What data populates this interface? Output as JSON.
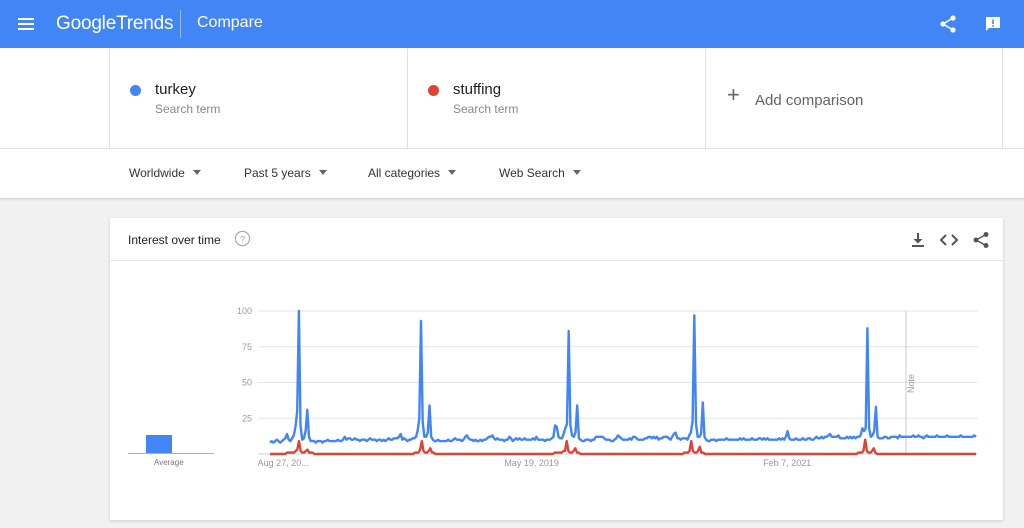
{
  "header": {
    "logo_google": "Google",
    "logo_trends": "Trends",
    "page_title": "Compare"
  },
  "terms": [
    {
      "name": "turkey",
      "subtitle": "Search term",
      "color": "#4285f4"
    },
    {
      "name": "stuffing",
      "subtitle": "Search term",
      "color": "#db4437"
    }
  ],
  "add_comparison": {
    "label": "Add comparison"
  },
  "filters": {
    "region": "Worldwide",
    "time": "Past 5 years",
    "category": "All categories",
    "search_type": "Web Search"
  },
  "card": {
    "title": "Interest over time",
    "average_label": "Average",
    "note_label": "Note"
  },
  "icons": [
    "menu-icon",
    "share-icon",
    "feedback-icon",
    "help-icon",
    "download-icon",
    "embed-icon",
    "share-icon"
  ],
  "chart_data": {
    "type": "line",
    "title": "",
    "x_tick_labels": [
      "Aug 27, 20...",
      "May 19, 2019",
      "Feb 7, 2021"
    ],
    "y_ticks": [
      25,
      50,
      75,
      100
    ],
    "ylim": [
      0,
      100
    ],
    "grid": true,
    "averages": {
      "turkey": 13,
      "stuffing": 1
    },
    "series": [
      {
        "name": "turkey",
        "color": "#4285f4",
        "values": [
          8,
          9,
          8,
          9,
          10,
          9,
          8,
          9,
          10,
          11,
          14,
          10,
          9,
          11,
          13,
          19,
          30,
          100,
          20,
          10,
          11,
          16,
          31,
          12,
          9,
          9,
          9,
          8,
          9,
          9,
          9,
          8,
          9,
          9,
          10,
          9,
          9,
          9,
          9,
          9,
          10,
          9,
          9,
          10,
          12,
          10,
          11,
          11,
          10,
          10,
          11,
          10,
          10,
          9,
          10,
          10,
          10,
          9,
          10,
          11,
          10,
          10,
          10,
          9,
          10,
          10,
          9,
          10,
          9,
          10,
          11,
          10,
          10,
          11,
          11,
          11,
          12,
          14,
          10,
          11,
          10,
          9,
          10,
          10,
          11,
          11,
          12,
          16,
          25,
          93,
          22,
          12,
          12,
          15,
          34,
          12,
          10,
          9,
          9,
          10,
          9,
          9,
          9,
          9,
          9,
          10,
          9,
          9,
          10,
          11,
          10,
          10,
          10,
          9,
          10,
          12,
          13,
          11,
          10,
          10,
          9,
          10,
          9,
          9,
          10,
          9,
          10,
          10,
          11,
          12,
          12,
          13,
          11,
          10,
          11,
          10,
          10,
          10,
          9,
          10,
          10,
          12,
          11,
          9,
          10,
          11,
          10,
          11,
          10,
          10,
          11,
          10,
          10,
          10,
          10,
          11,
          10,
          12,
          10,
          10,
          10,
          10,
          9,
          10,
          10,
          10,
          11,
          12,
          20,
          19,
          12,
          11,
          11,
          14,
          18,
          21,
          86,
          20,
          13,
          12,
          15,
          34,
          11,
          10,
          9,
          9,
          10,
          10,
          10,
          9,
          10,
          10,
          12,
          12,
          12,
          12,
          12,
          11,
          10,
          10,
          10,
          9,
          9,
          10,
          11,
          13,
          12,
          11,
          10,
          10,
          10,
          10,
          11,
          10,
          12,
          12,
          11,
          10,
          10,
          10,
          10,
          11,
          11,
          12,
          12,
          11,
          12,
          11,
          12,
          10,
          11,
          11,
          12,
          12,
          12,
          11,
          10,
          12,
          14,
          15,
          11,
          11,
          10,
          11,
          11,
          11,
          10,
          13,
          15,
          23,
          97,
          21,
          12,
          12,
          14,
          36,
          12,
          10,
          9,
          9,
          10,
          10,
          10,
          9,
          10,
          10,
          10,
          10,
          10,
          11,
          10,
          10,
          10,
          10,
          10,
          10,
          10,
          11,
          10,
          11,
          10,
          10,
          10,
          10,
          11,
          10,
          10,
          10,
          11,
          11,
          10,
          11,
          10,
          11,
          10,
          10,
          10,
          10,
          10,
          10,
          11,
          10,
          11,
          10,
          12,
          16,
          11,
          10,
          10,
          10,
          11,
          10,
          10,
          10,
          11,
          10,
          10,
          11,
          11,
          10,
          10,
          11,
          12,
          11,
          11,
          12,
          11,
          12,
          12,
          13,
          14,
          12,
          12,
          12,
          12,
          13,
          11,
          11,
          11,
          11,
          12,
          11,
          12,
          11,
          12,
          11,
          12,
          12,
          13,
          18,
          16,
          18,
          88,
          18,
          12,
          13,
          16,
          33,
          12,
          11,
          11,
          11,
          12,
          12,
          11,
          11,
          12,
          12,
          12,
          12,
          11,
          13,
          12,
          12,
          12,
          12,
          12,
          12,
          12,
          13,
          12,
          12,
          13,
          12,
          12,
          11,
          12,
          13,
          12,
          12,
          12,
          12,
          12,
          13,
          12,
          12,
          12,
          12,
          12,
          13,
          12,
          12,
          12,
          12,
          12,
          12,
          12,
          13,
          12,
          12,
          12,
          12,
          12,
          12,
          12,
          13,
          12
        ]
      },
      {
        "name": "stuffing",
        "color": "#db4437",
        "values": [
          0,
          0,
          0,
          0,
          0,
          0,
          0,
          0,
          0,
          0,
          1,
          1,
          1,
          1,
          1,
          2,
          3,
          9,
          2,
          1,
          1,
          2,
          3,
          1,
          1,
          1,
          0,
          0,
          0,
          0,
          0,
          0,
          0,
          0,
          0,
          0,
          0,
          0,
          0,
          0,
          0,
          0,
          0,
          0,
          0,
          0,
          0,
          0,
          0,
          0,
          0,
          0,
          0,
          0,
          0,
          0,
          0,
          0,
          0,
          0,
          0,
          0,
          0,
          0,
          0,
          0,
          0,
          0,
          0,
          0,
          0,
          0,
          0,
          0,
          0,
          0,
          0,
          0,
          0,
          0,
          0,
          0,
          0,
          0,
          0,
          1,
          1,
          1,
          3,
          9,
          2,
          1,
          1,
          2,
          4,
          1,
          1,
          0,
          0,
          0,
          0,
          0,
          0,
          0,
          0,
          0,
          0,
          0,
          0,
          0,
          0,
          0,
          0,
          0,
          0,
          0,
          0,
          0,
          0,
          0,
          0,
          0,
          0,
          0,
          0,
          0,
          0,
          0,
          0,
          0,
          0,
          0,
          0,
          0,
          0,
          0,
          0,
          0,
          0,
          0,
          0,
          0,
          0,
          0,
          0,
          0,
          0,
          0,
          0,
          0,
          0,
          0,
          0,
          0,
          0,
          0,
          0,
          0,
          0,
          0,
          0,
          0,
          0,
          0,
          0,
          0,
          0,
          1,
          1,
          1,
          1,
          1,
          2,
          2,
          9,
          2,
          1,
          1,
          2,
          4,
          1,
          1,
          0,
          0,
          0,
          0,
          0,
          0,
          0,
          0,
          0,
          0,
          0,
          0,
          0,
          0,
          0,
          0,
          0,
          0,
          0,
          0,
          0,
          0,
          0,
          0,
          0,
          0,
          0,
          0,
          0,
          0,
          0,
          0,
          0,
          0,
          0,
          0,
          0,
          0,
          0,
          0,
          0,
          0,
          0,
          0,
          0,
          0,
          0,
          0,
          0,
          0,
          0,
          0,
          0,
          0,
          0,
          0,
          0,
          0,
          0,
          0,
          0,
          1,
          1,
          1,
          2,
          9,
          2,
          1,
          1,
          2,
          5,
          1,
          1,
          0,
          0,
          0,
          0,
          0,
          0,
          0,
          0,
          0,
          0,
          0,
          0,
          0,
          0,
          0,
          0,
          0,
          0,
          0,
          0,
          0,
          0,
          0,
          0,
          0,
          0,
          0,
          0,
          0,
          0,
          0,
          0,
          0,
          0,
          0,
          0,
          0,
          0,
          0,
          0,
          0,
          0,
          0,
          0,
          0,
          0,
          0,
          0,
          0,
          0,
          0,
          0,
          0,
          0,
          0,
          0,
          0,
          0,
          0,
          0,
          0,
          0,
          0,
          0,
          0,
          0,
          0,
          0,
          0,
          0,
          0,
          0,
          0,
          0,
          0,
          0,
          0,
          0,
          0,
          0,
          0,
          0,
          0,
          0,
          0,
          0,
          0,
          0,
          0,
          0,
          1,
          1,
          1,
          2,
          10,
          2,
          1,
          1,
          2,
          4,
          1,
          0,
          0,
          0,
          0,
          0,
          0,
          0,
          0,
          0,
          0,
          0,
          0,
          0,
          0,
          0,
          0,
          0,
          0,
          0,
          0,
          0,
          0,
          0,
          0,
          0,
          0,
          0,
          0,
          0,
          0,
          0,
          0,
          0,
          0,
          0,
          0,
          0,
          0,
          0,
          0,
          0,
          0,
          0,
          0,
          0,
          0,
          0,
          0,
          0,
          0,
          0,
          0,
          0,
          0,
          0,
          0,
          0,
          0,
          0
        ]
      }
    ]
  }
}
